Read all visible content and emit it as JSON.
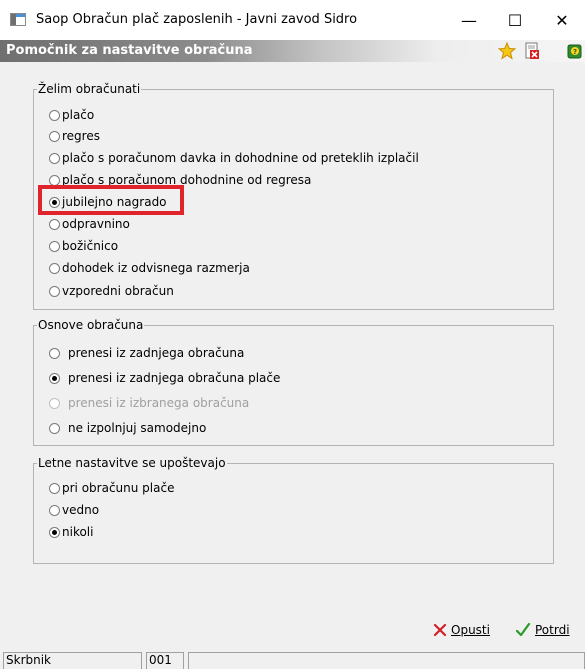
{
  "window": {
    "title": "Saop Obračun plač zaposlenih - Javni zavod Sidro",
    "minimize": "—",
    "maximize": "☐",
    "close": "✕"
  },
  "header": {
    "title": "Pomočnik za nastavitve obračuna",
    "icons": [
      "favorite-star-icon",
      "close-document-icon",
      "help-book-icon"
    ]
  },
  "group1": {
    "legend": "Želim obračunati",
    "options": [
      {
        "label": "plačo",
        "checked": false
      },
      {
        "label": "regres",
        "checked": false
      },
      {
        "label": "plačo s poračunom davka in dohodnine od preteklih izplačil",
        "checked": false
      },
      {
        "label": "plačo s poračunom dohodnine od regresa",
        "checked": false
      },
      {
        "label": "jubilejno nagrado",
        "checked": true
      },
      {
        "label": "odpravnino",
        "checked": false
      },
      {
        "label": "božičnico",
        "checked": false
      },
      {
        "label": "dohodek iz odvisnega razmerja",
        "checked": false
      },
      {
        "label": "vzporedni obračun",
        "checked": false
      }
    ]
  },
  "group2": {
    "legend": "Osnove obračuna",
    "options": [
      {
        "label": "prenesi iz zadnjega obračuna",
        "checked": false,
        "enabled": true
      },
      {
        "label": "prenesi iz zadnjega obračuna plače",
        "checked": true,
        "enabled": true
      },
      {
        "label": "prenesi iz izbranega obračuna",
        "checked": false,
        "enabled": false
      },
      {
        "label": "ne izpolnjuj samodejno",
        "checked": false,
        "enabled": true
      }
    ]
  },
  "group3": {
    "legend": "Letne nastavitve se upoštevajo",
    "options": [
      {
        "label": "pri obračunu plače",
        "checked": false
      },
      {
        "label": "vedno",
        "checked": false
      },
      {
        "label": "nikoli",
        "checked": true
      }
    ]
  },
  "footer": {
    "cancel_label": "Opusti",
    "confirm_label": "Potrdi",
    "accent_cancel": "#d0202a",
    "accent_confirm": "#2a9a2a"
  },
  "statusbar": {
    "user": "Skrbnik",
    "code": "001",
    "message": ""
  },
  "colors": {
    "highlight": "#e0242c",
    "header_dark": "#6f6f6f"
  }
}
